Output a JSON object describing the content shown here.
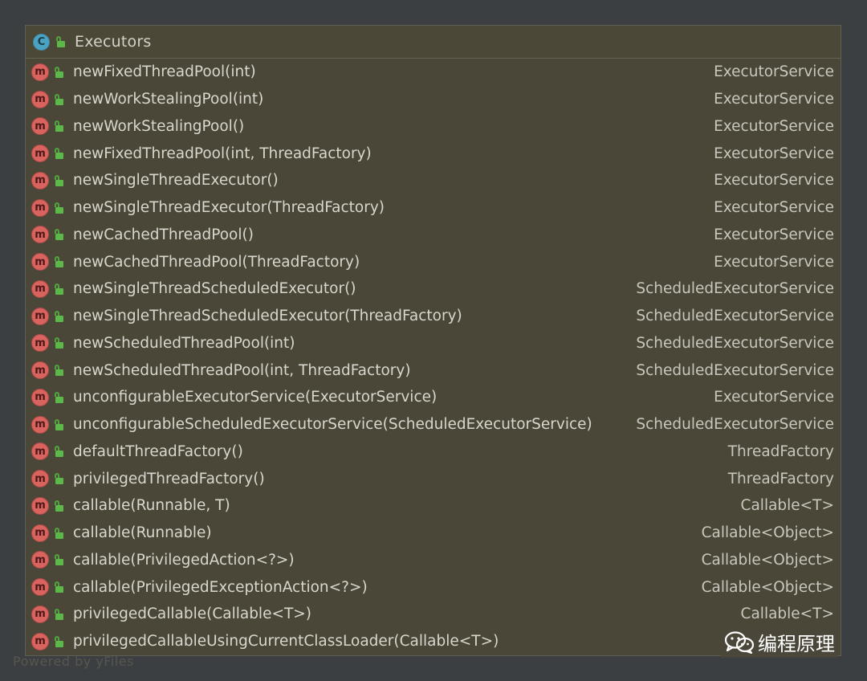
{
  "header": {
    "class_icon_letter": "C",
    "title": "Executors"
  },
  "icons": {
    "method_letter": "m",
    "method_color": "#d9635e",
    "class_color": "#4ba3c3",
    "lock_color": "#5db84a"
  },
  "methods": [
    {
      "signature": "newFixedThreadPool(int)",
      "returns": "ExecutorService"
    },
    {
      "signature": "newWorkStealingPool(int)",
      "returns": "ExecutorService"
    },
    {
      "signature": "newWorkStealingPool()",
      "returns": "ExecutorService"
    },
    {
      "signature": "newFixedThreadPool(int, ThreadFactory)",
      "returns": "ExecutorService"
    },
    {
      "signature": "newSingleThreadExecutor()",
      "returns": "ExecutorService"
    },
    {
      "signature": "newSingleThreadExecutor(ThreadFactory)",
      "returns": "ExecutorService"
    },
    {
      "signature": "newCachedThreadPool()",
      "returns": "ExecutorService"
    },
    {
      "signature": "newCachedThreadPool(ThreadFactory)",
      "returns": "ExecutorService"
    },
    {
      "signature": "newSingleThreadScheduledExecutor()",
      "returns": "ScheduledExecutorService"
    },
    {
      "signature": "newSingleThreadScheduledExecutor(ThreadFactory)",
      "returns": "ScheduledExecutorService"
    },
    {
      "signature": "newScheduledThreadPool(int)",
      "returns": "ScheduledExecutorService"
    },
    {
      "signature": "newScheduledThreadPool(int, ThreadFactory)",
      "returns": "ScheduledExecutorService"
    },
    {
      "signature": "unconfigurableExecutorService(ExecutorService)",
      "returns": "ExecutorService"
    },
    {
      "signature": "unconfigurableScheduledExecutorService(ScheduledExecutorService)",
      "returns": "ScheduledExecutorService"
    },
    {
      "signature": "defaultThreadFactory()",
      "returns": "ThreadFactory"
    },
    {
      "signature": "privilegedThreadFactory()",
      "returns": "ThreadFactory"
    },
    {
      "signature": "callable(Runnable, T)",
      "returns": "Callable<T>"
    },
    {
      "signature": "callable(Runnable)",
      "returns": "Callable<Object>"
    },
    {
      "signature": "callable(PrivilegedAction<?>)",
      "returns": "Callable<Object>"
    },
    {
      "signature": "callable(PrivilegedExceptionAction<?>)",
      "returns": "Callable<Object>"
    },
    {
      "signature": "privilegedCallable(Callable<T>)",
      "returns": "Callable<T>"
    },
    {
      "signature": "privilegedCallableUsingCurrentClassLoader(Callable<T>)",
      "returns": ""
    }
  ],
  "footer": {
    "watermark": "Powered by yFiles",
    "brand_text": "编程原理"
  }
}
